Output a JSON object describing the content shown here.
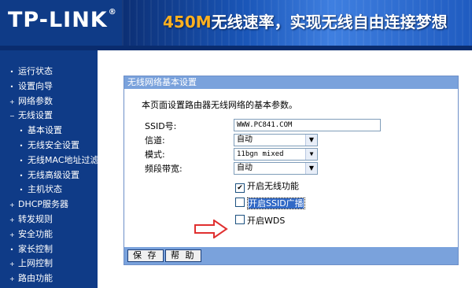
{
  "header": {
    "logo": "TP-LINK",
    "logo_mark": "®",
    "banner_highlight": "450M",
    "banner_text": "无线速率，实现无线自由连接梦想"
  },
  "sidebar": {
    "items": [
      {
        "label": "运行状态",
        "bullet": "•"
      },
      {
        "label": "设置向导",
        "bullet": "•"
      },
      {
        "label": "网络参数",
        "bullet": "+"
      },
      {
        "label": "无线设置",
        "bullet": "−"
      },
      {
        "label": "基本设置",
        "bullet": "•"
      },
      {
        "label": "无线安全设置",
        "bullet": "•"
      },
      {
        "label": "无线MAC地址过滤",
        "bullet": "•"
      },
      {
        "label": "无线高级设置",
        "bullet": "•"
      },
      {
        "label": "主机状态",
        "bullet": "•"
      },
      {
        "label": "DHCP服务器",
        "bullet": "+"
      },
      {
        "label": "转发规则",
        "bullet": "+"
      },
      {
        "label": "安全功能",
        "bullet": "+"
      },
      {
        "label": "家长控制",
        "bullet": "•"
      },
      {
        "label": "上网控制",
        "bullet": "+"
      },
      {
        "label": "路由功能",
        "bullet": "+"
      }
    ]
  },
  "panel": {
    "title": "无线网络基本设置",
    "description": "本页面设置路由器无线网络的基本参数。",
    "ssid_label": "SSID号:",
    "ssid_value": "WWW.PC841.COM",
    "channel_label": "信道:",
    "channel_value": "自动",
    "mode_label": "模式:",
    "mode_value": "11bgn mixed",
    "bandwidth_label": "频段带宽:",
    "bandwidth_value": "自动",
    "enable_wireless_label": "开启无线功能",
    "enable_wireless_checked": true,
    "enable_ssid_broadcast_label": "开启SSID广播",
    "enable_ssid_broadcast_checked": false,
    "enable_wds_label": "开启WDS",
    "enable_wds_checked": false,
    "save_label": "保 存",
    "help_label": "帮 助"
  },
  "colors": {
    "nav_bg": "#0f3b87",
    "panel_bar": "#7aa2dc",
    "arrow": "#e03030",
    "banner_highlight": "#ffb020"
  }
}
